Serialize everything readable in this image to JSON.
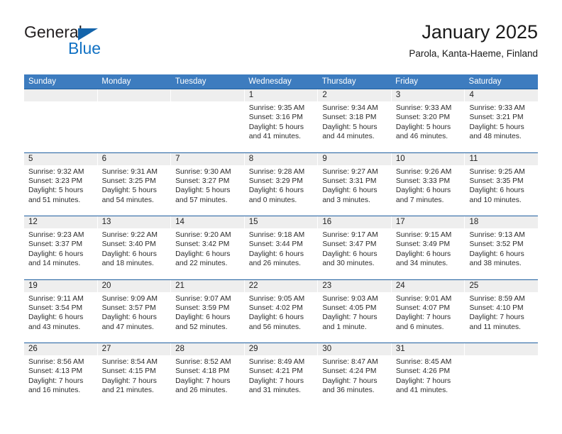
{
  "logo": {
    "word1": "General",
    "word2": "Blue",
    "triangle_color": "#1464ab",
    "blue_color": "#1272c4"
  },
  "header": {
    "title": "January 2025",
    "subtitle": "Parola, Kanta-Haeme, Finland"
  },
  "theme": {
    "header_bg": "#3d7cbf",
    "week_rule": "#1f5fa0",
    "day_band_bg": "#eeeeee"
  },
  "weekdays": [
    "Sunday",
    "Monday",
    "Tuesday",
    "Wednesday",
    "Thursday",
    "Friday",
    "Saturday"
  ],
  "weeks": [
    [
      {
        "day": "",
        "sunrise": "",
        "sunset": "",
        "daylight1": "",
        "daylight2": ""
      },
      {
        "day": "",
        "sunrise": "",
        "sunset": "",
        "daylight1": "",
        "daylight2": ""
      },
      {
        "day": "",
        "sunrise": "",
        "sunset": "",
        "daylight1": "",
        "daylight2": ""
      },
      {
        "day": "1",
        "sunrise": "Sunrise: 9:35 AM",
        "sunset": "Sunset: 3:16 PM",
        "daylight1": "Daylight: 5 hours",
        "daylight2": "and 41 minutes."
      },
      {
        "day": "2",
        "sunrise": "Sunrise: 9:34 AM",
        "sunset": "Sunset: 3:18 PM",
        "daylight1": "Daylight: 5 hours",
        "daylight2": "and 44 minutes."
      },
      {
        "day": "3",
        "sunrise": "Sunrise: 9:33 AM",
        "sunset": "Sunset: 3:20 PM",
        "daylight1": "Daylight: 5 hours",
        "daylight2": "and 46 minutes."
      },
      {
        "day": "4",
        "sunrise": "Sunrise: 9:33 AM",
        "sunset": "Sunset: 3:21 PM",
        "daylight1": "Daylight: 5 hours",
        "daylight2": "and 48 minutes."
      }
    ],
    [
      {
        "day": "5",
        "sunrise": "Sunrise: 9:32 AM",
        "sunset": "Sunset: 3:23 PM",
        "daylight1": "Daylight: 5 hours",
        "daylight2": "and 51 minutes."
      },
      {
        "day": "6",
        "sunrise": "Sunrise: 9:31 AM",
        "sunset": "Sunset: 3:25 PM",
        "daylight1": "Daylight: 5 hours",
        "daylight2": "and 54 minutes."
      },
      {
        "day": "7",
        "sunrise": "Sunrise: 9:30 AM",
        "sunset": "Sunset: 3:27 PM",
        "daylight1": "Daylight: 5 hours",
        "daylight2": "and 57 minutes."
      },
      {
        "day": "8",
        "sunrise": "Sunrise: 9:28 AM",
        "sunset": "Sunset: 3:29 PM",
        "daylight1": "Daylight: 6 hours",
        "daylight2": "and 0 minutes."
      },
      {
        "day": "9",
        "sunrise": "Sunrise: 9:27 AM",
        "sunset": "Sunset: 3:31 PM",
        "daylight1": "Daylight: 6 hours",
        "daylight2": "and 3 minutes."
      },
      {
        "day": "10",
        "sunrise": "Sunrise: 9:26 AM",
        "sunset": "Sunset: 3:33 PM",
        "daylight1": "Daylight: 6 hours",
        "daylight2": "and 7 minutes."
      },
      {
        "day": "11",
        "sunrise": "Sunrise: 9:25 AM",
        "sunset": "Sunset: 3:35 PM",
        "daylight1": "Daylight: 6 hours",
        "daylight2": "and 10 minutes."
      }
    ],
    [
      {
        "day": "12",
        "sunrise": "Sunrise: 9:23 AM",
        "sunset": "Sunset: 3:37 PM",
        "daylight1": "Daylight: 6 hours",
        "daylight2": "and 14 minutes."
      },
      {
        "day": "13",
        "sunrise": "Sunrise: 9:22 AM",
        "sunset": "Sunset: 3:40 PM",
        "daylight1": "Daylight: 6 hours",
        "daylight2": "and 18 minutes."
      },
      {
        "day": "14",
        "sunrise": "Sunrise: 9:20 AM",
        "sunset": "Sunset: 3:42 PM",
        "daylight1": "Daylight: 6 hours",
        "daylight2": "and 22 minutes."
      },
      {
        "day": "15",
        "sunrise": "Sunrise: 9:18 AM",
        "sunset": "Sunset: 3:44 PM",
        "daylight1": "Daylight: 6 hours",
        "daylight2": "and 26 minutes."
      },
      {
        "day": "16",
        "sunrise": "Sunrise: 9:17 AM",
        "sunset": "Sunset: 3:47 PM",
        "daylight1": "Daylight: 6 hours",
        "daylight2": "and 30 minutes."
      },
      {
        "day": "17",
        "sunrise": "Sunrise: 9:15 AM",
        "sunset": "Sunset: 3:49 PM",
        "daylight1": "Daylight: 6 hours",
        "daylight2": "and 34 minutes."
      },
      {
        "day": "18",
        "sunrise": "Sunrise: 9:13 AM",
        "sunset": "Sunset: 3:52 PM",
        "daylight1": "Daylight: 6 hours",
        "daylight2": "and 38 minutes."
      }
    ],
    [
      {
        "day": "19",
        "sunrise": "Sunrise: 9:11 AM",
        "sunset": "Sunset: 3:54 PM",
        "daylight1": "Daylight: 6 hours",
        "daylight2": "and 43 minutes."
      },
      {
        "day": "20",
        "sunrise": "Sunrise: 9:09 AM",
        "sunset": "Sunset: 3:57 PM",
        "daylight1": "Daylight: 6 hours",
        "daylight2": "and 47 minutes."
      },
      {
        "day": "21",
        "sunrise": "Sunrise: 9:07 AM",
        "sunset": "Sunset: 3:59 PM",
        "daylight1": "Daylight: 6 hours",
        "daylight2": "and 52 minutes."
      },
      {
        "day": "22",
        "sunrise": "Sunrise: 9:05 AM",
        "sunset": "Sunset: 4:02 PM",
        "daylight1": "Daylight: 6 hours",
        "daylight2": "and 56 minutes."
      },
      {
        "day": "23",
        "sunrise": "Sunrise: 9:03 AM",
        "sunset": "Sunset: 4:05 PM",
        "daylight1": "Daylight: 7 hours",
        "daylight2": "and 1 minute."
      },
      {
        "day": "24",
        "sunrise": "Sunrise: 9:01 AM",
        "sunset": "Sunset: 4:07 PM",
        "daylight1": "Daylight: 7 hours",
        "daylight2": "and 6 minutes."
      },
      {
        "day": "25",
        "sunrise": "Sunrise: 8:59 AM",
        "sunset": "Sunset: 4:10 PM",
        "daylight1": "Daylight: 7 hours",
        "daylight2": "and 11 minutes."
      }
    ],
    [
      {
        "day": "26",
        "sunrise": "Sunrise: 8:56 AM",
        "sunset": "Sunset: 4:13 PM",
        "daylight1": "Daylight: 7 hours",
        "daylight2": "and 16 minutes."
      },
      {
        "day": "27",
        "sunrise": "Sunrise: 8:54 AM",
        "sunset": "Sunset: 4:15 PM",
        "daylight1": "Daylight: 7 hours",
        "daylight2": "and 21 minutes."
      },
      {
        "day": "28",
        "sunrise": "Sunrise: 8:52 AM",
        "sunset": "Sunset: 4:18 PM",
        "daylight1": "Daylight: 7 hours",
        "daylight2": "and 26 minutes."
      },
      {
        "day": "29",
        "sunrise": "Sunrise: 8:49 AM",
        "sunset": "Sunset: 4:21 PM",
        "daylight1": "Daylight: 7 hours",
        "daylight2": "and 31 minutes."
      },
      {
        "day": "30",
        "sunrise": "Sunrise: 8:47 AM",
        "sunset": "Sunset: 4:24 PM",
        "daylight1": "Daylight: 7 hours",
        "daylight2": "and 36 minutes."
      },
      {
        "day": "31",
        "sunrise": "Sunrise: 8:45 AM",
        "sunset": "Sunset: 4:26 PM",
        "daylight1": "Daylight: 7 hours",
        "daylight2": "and 41 minutes."
      },
      {
        "day": "",
        "sunrise": "",
        "sunset": "",
        "daylight1": "",
        "daylight2": ""
      }
    ]
  ]
}
